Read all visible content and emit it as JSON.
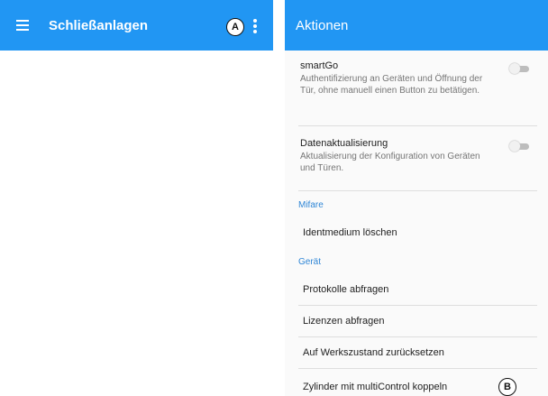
{
  "left_screen": {
    "title": "Schließanlagen",
    "marker": "A"
  },
  "right_screen": {
    "title": "Aktionen",
    "settings": [
      {
        "title": "smartGo",
        "description": "Authentifizierung an Geräten und Öffnung der Tür, ohne manuell einen Button zu betätigen.",
        "enabled": false
      },
      {
        "title": "Datenaktualisierung",
        "description": "Aktualisierung der Konfiguration von Geräten und Türen.",
        "enabled": false
      }
    ],
    "categories": {
      "mifare": "Mifare",
      "geraet": "Gerät"
    },
    "actions": {
      "identmedium": "Identmedium löschen",
      "protokolle": "Protokolle abfragen",
      "lizenzen": "Lizenzen abfragen",
      "werkszustand": "Auf Werkszustand zurücksetzen",
      "zylinder": "Zylinder mit multiControl koppeln"
    },
    "marker": "B"
  },
  "colors": {
    "app_bar": "#2196f3",
    "category_text": "#2f86d6",
    "toggle_off": "#bdbdbd"
  }
}
